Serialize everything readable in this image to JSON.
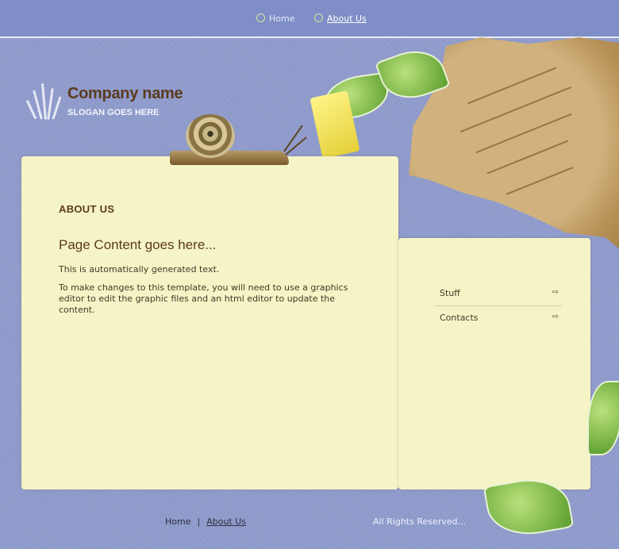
{
  "nav": {
    "home_label": "Home",
    "about_label": "About Us"
  },
  "brand": {
    "company_name": "Company name",
    "slogan": "SLOGAN GOES HERE"
  },
  "main": {
    "section_heading": "ABOUT US",
    "content_title": "Page Content goes here...",
    "paragraph1": "This is automatically generated text.",
    "paragraph2": "To make changes to this template, you will need to use a graphics editor to edit the graphic files and an html editor to update the content."
  },
  "sidebar": {
    "items": [
      {
        "label": "Stuff",
        "icon": "arrow-right-icon"
      },
      {
        "label": "Contacts",
        "icon": "arrow-right-icon"
      }
    ]
  },
  "footer": {
    "home_label": "Home",
    "about_label": "About Us",
    "separator": "|",
    "copyright": "All Rights Reserved..."
  },
  "colors": {
    "background": "#8f9bcc",
    "topbar": "#7f8ec6",
    "paper": "#f5f4c6",
    "brand_brown": "#5b3a1e"
  }
}
